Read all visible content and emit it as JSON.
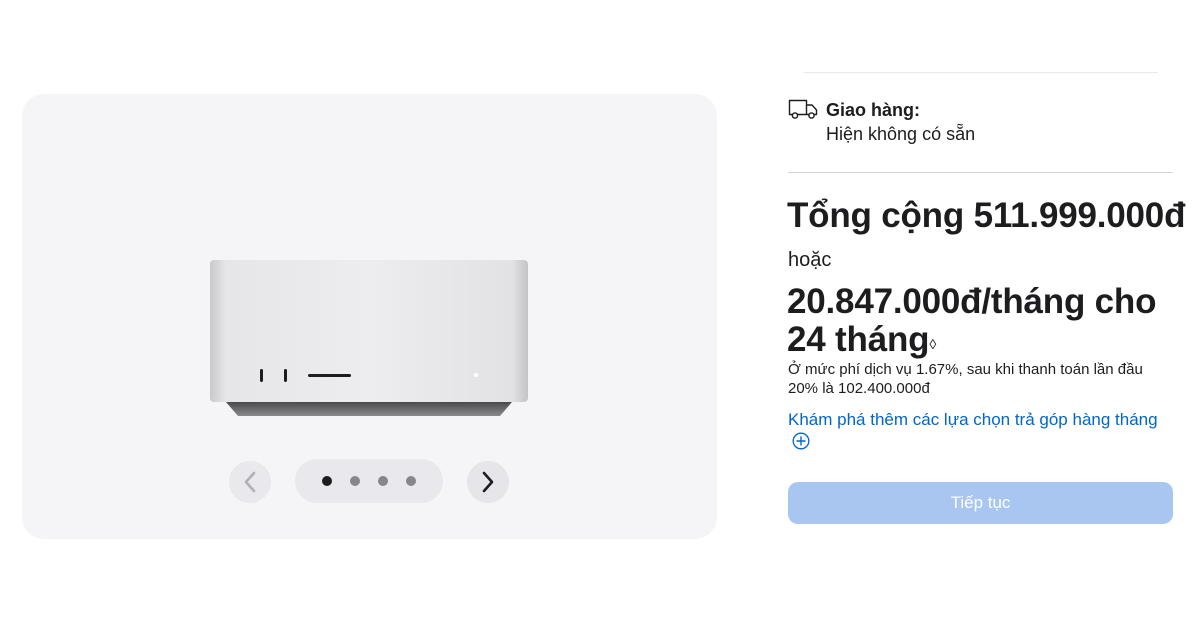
{
  "delivery": {
    "icon": "truck-icon",
    "label": "Giao hàng:",
    "status": "Hiện không có sẵn"
  },
  "pricing": {
    "total": "Tổng cộng 511.999.000đ",
    "or": "hoặc",
    "monthly_line": "20.847.000đ/tháng cho 24 tháng",
    "monthly_marker": "◊",
    "fee_note": "Ở mức phí dịch vụ 1.67%, sau khi thanh toán lần đầu 20% là 102.400.000đ"
  },
  "explore": {
    "link_text": "Khám phá thêm các lựa chọn trả góp hàng tháng",
    "icon": "plus-circle-icon"
  },
  "actions": {
    "continue_label": "Tiếp tục"
  },
  "gallery": {
    "slide_count": 4,
    "active_index": 0,
    "prev_icon": "chevron-left-icon",
    "next_icon": "chevron-right-icon"
  },
  "colors": {
    "link": "#0066cc",
    "button_disabled": "#a8c6f0",
    "gallery_bg": "#f5f5f7"
  }
}
